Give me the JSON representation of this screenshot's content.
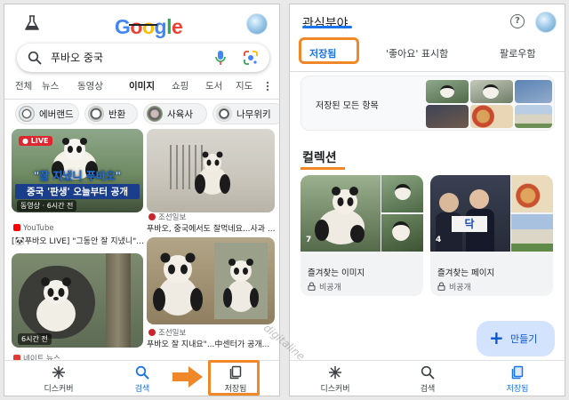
{
  "left_screen": {
    "logo": "Google",
    "search": {
      "query": "푸바오 중국"
    },
    "tabs": [
      {
        "label": "전체"
      },
      {
        "label": "뉴스"
      },
      {
        "label": "동영상"
      },
      {
        "label": "이미지",
        "active": true
      },
      {
        "label": "쇼핑"
      },
      {
        "label": "도서"
      },
      {
        "label": "지도"
      }
    ],
    "chips": [
      {
        "label": "에버랜드"
      },
      {
        "label": "반환"
      },
      {
        "label": "사육사"
      },
      {
        "label": "나무위키"
      }
    ],
    "results": [
      {
        "live_badge": "● LIVE",
        "headline_1": "\"잘 지냈니 푸바오\"",
        "headline_2": "중국 '판생' 오늘부터 공개",
        "meta": "동영상 · 6시간 전",
        "source": "YouTube",
        "title": "[🐼푸바오 LIVE] \"그동안 잘 지냈니\"..."
      },
      {
        "source": "조선일보",
        "title": "푸바오, 중국에서도 잘먹네요...사과 ..."
      },
      {
        "time_badge": "6시간 전",
        "source": "네이트 뉴스"
      },
      {
        "source": "조선일보",
        "title": "푸바오 잘 지내요\"...中센터가 공개..."
      }
    ],
    "bottom_nav": [
      {
        "label": "디스커버",
        "icon": "discover-icon"
      },
      {
        "label": "검색",
        "icon": "search-icon"
      },
      {
        "label": "저장됨",
        "icon": "saved-icon"
      }
    ]
  },
  "right_screen": {
    "title": "관심분야",
    "tabs": [
      {
        "label": "저장됨",
        "active": true
      },
      {
        "label": "'좋아요' 표시함"
      },
      {
        "label": "팔로우함"
      }
    ],
    "all_saved_label": "저장된 모든 항목",
    "collections_title": "컬렉션",
    "collections": [
      {
        "count": "7",
        "name": "즐겨찾는 이미지",
        "privacy": "비공개"
      },
      {
        "count": "4",
        "name": "즐겨찾는 페이지",
        "privacy": "비공개"
      }
    ],
    "fab_label": "만들기",
    "bottom_nav": [
      {
        "label": "디스커버",
        "icon": "discover-icon"
      },
      {
        "label": "검색",
        "icon": "search-icon"
      },
      {
        "label": "저장됨",
        "icon": "saved-icon",
        "active": true
      }
    ]
  },
  "watermark": "digitaline",
  "colors": {
    "google_blue": "#4285F4",
    "google_red": "#EA4335",
    "google_yellow": "#FBBC05",
    "google_green": "#34A853",
    "active_blue": "#1a73e8",
    "highlight_orange": "#f0882a",
    "fab_bg": "#d3e3fd"
  }
}
